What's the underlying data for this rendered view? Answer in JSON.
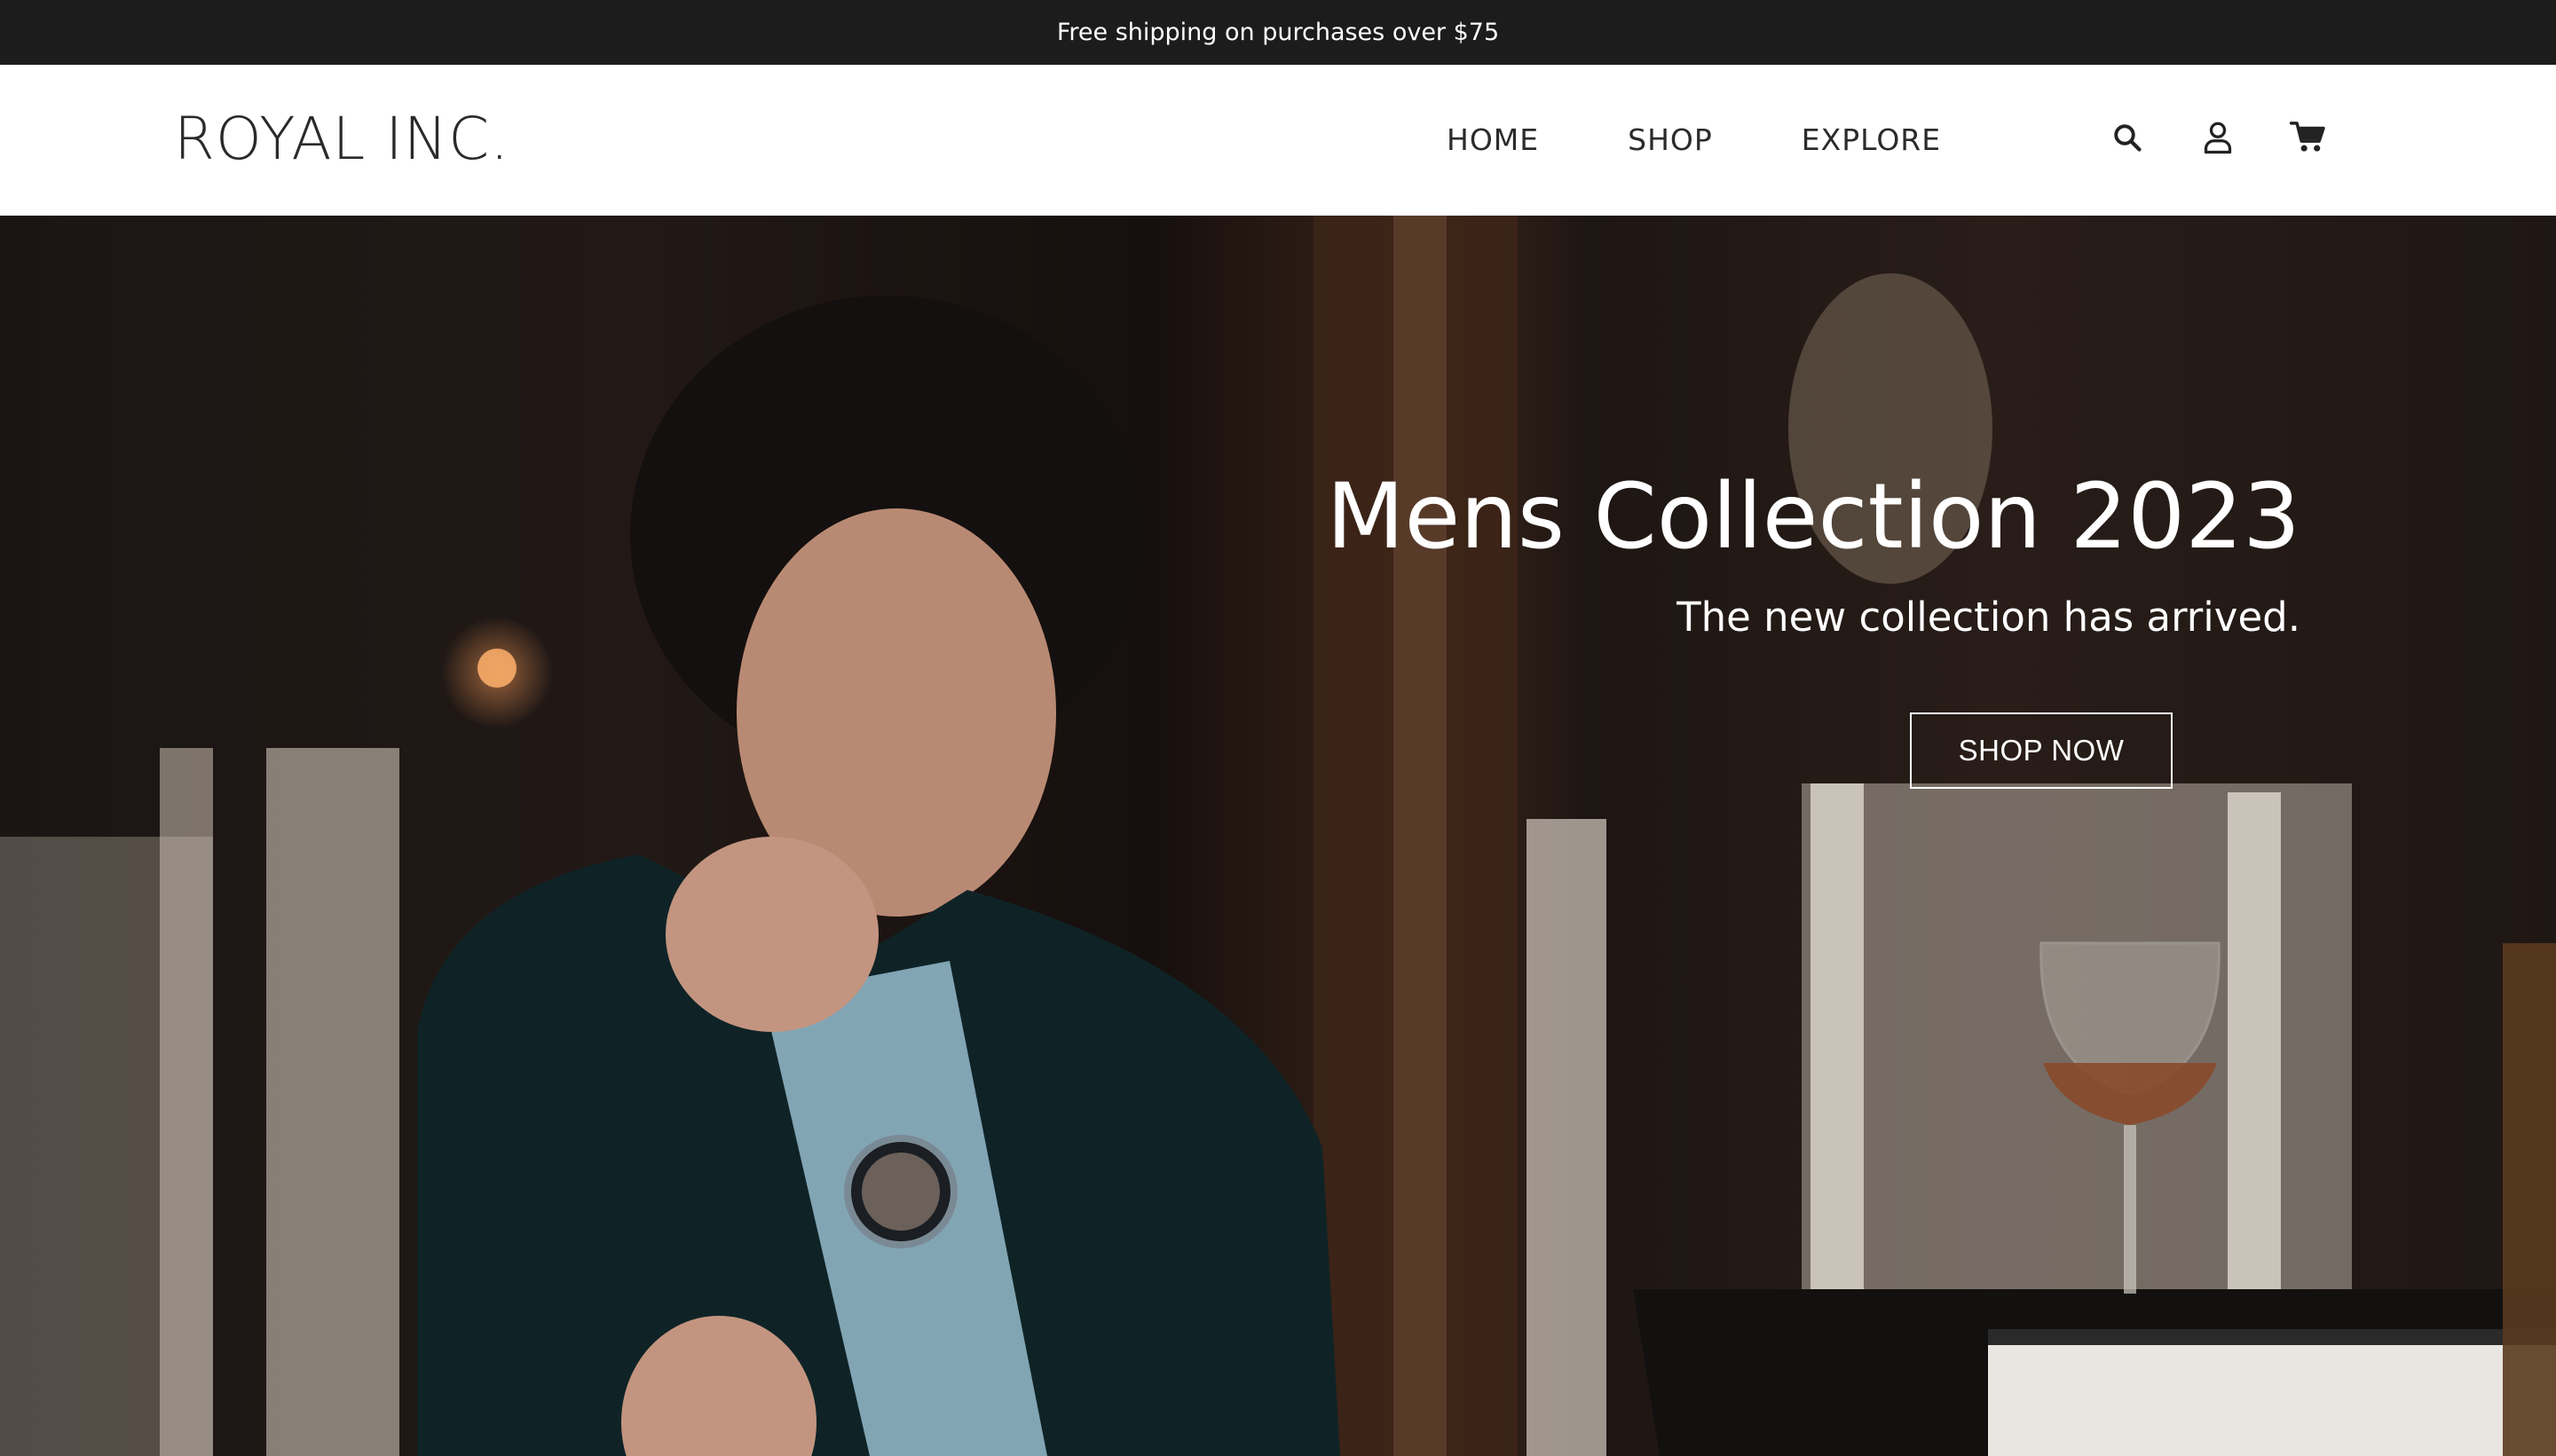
{
  "announcement": {
    "text": "Free shipping on purchases over $75"
  },
  "header": {
    "logo": "ROYAL INC.",
    "nav": [
      {
        "label": "HOME"
      },
      {
        "label": "SHOP"
      },
      {
        "label": "EXPLORE"
      }
    ],
    "icons": [
      "search-icon",
      "user-icon",
      "cart-icon"
    ]
  },
  "hero": {
    "title": "Mens Collection 2023",
    "subtitle": "The new collection has arrived.",
    "cta_label": "SHOP NOW",
    "image_description": "man in dark suit wearing wristwatch seated in restaurant with wooden chairs and wine glass"
  },
  "colors": {
    "announcement_bg": "#1c1c1c",
    "header_bg": "#ffffff",
    "text_dark": "#2a2a2a",
    "hero_text": "#ffffff"
  }
}
